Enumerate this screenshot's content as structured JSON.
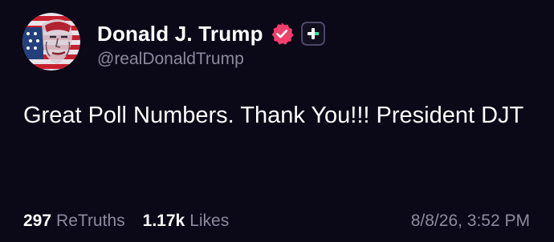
{
  "profile": {
    "display_name": "Donald J. Trump",
    "handle": "@realDonaldTrump",
    "verified_icon": "verified-badge-icon",
    "plus_icon": "plus-icon"
  },
  "post": {
    "text": "Great Poll Numbers. Thank You!!! President DJT"
  },
  "stats": {
    "retruths_count": "297",
    "retruths_label": "ReTruths",
    "likes_count": "1.17k",
    "likes_label": "Likes"
  },
  "timestamp": "8/8/26, 3:52 PM",
  "colors": {
    "background": "#0b0818",
    "text_primary": "#ffffff",
    "text_secondary": "#8e8a9e",
    "verified": "#f23f6b",
    "plus_accent": "#2ee6a8"
  }
}
